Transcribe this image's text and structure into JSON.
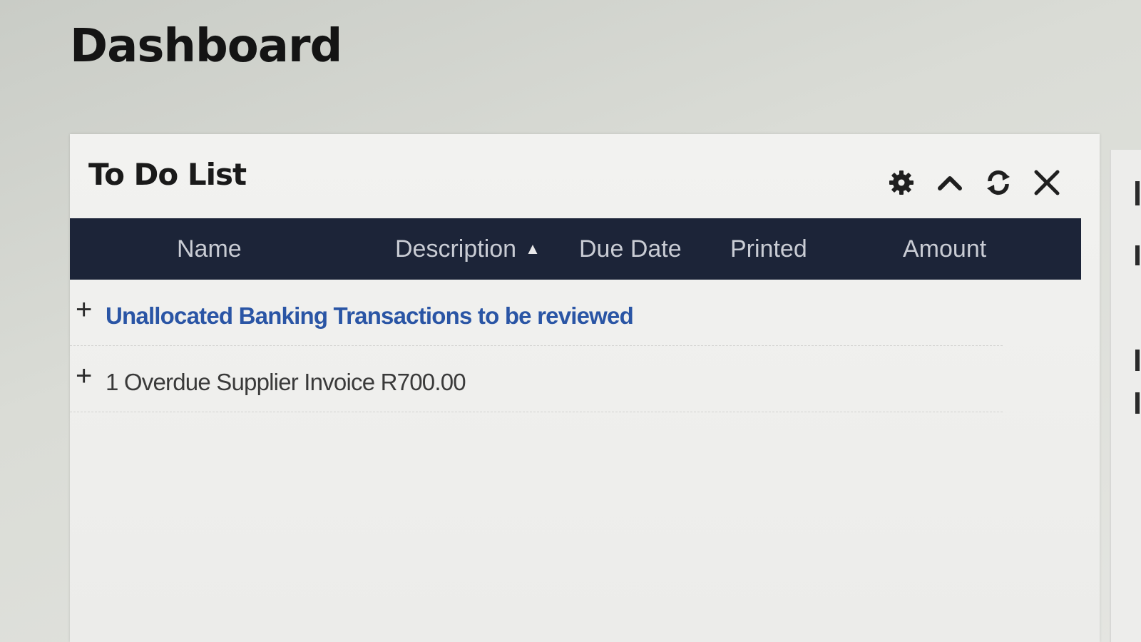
{
  "page": {
    "title": "Dashboard"
  },
  "todo_panel": {
    "title": "To Do List",
    "tools": [
      {
        "name": "settings",
        "icon": "gear-icon"
      },
      {
        "name": "collapse",
        "icon": "chevron-up-icon"
      },
      {
        "name": "refresh",
        "icon": "refresh-icon"
      },
      {
        "name": "close",
        "icon": "close-icon"
      }
    ],
    "columns": [
      {
        "label": "Name"
      },
      {
        "label": "Description",
        "sort": "ascending"
      },
      {
        "label": "Due Date"
      },
      {
        "label": "Printed"
      },
      {
        "label": "Amount"
      }
    ],
    "rows": [
      {
        "expand": "+",
        "text": "Unallocated Banking Transactions to be reviewed",
        "is_link": true
      },
      {
        "expand": "+",
        "text": "1 Overdue Supplier Invoice R700.00",
        "is_link": false
      }
    ]
  },
  "colors": {
    "table_header_bg": "#1c2438",
    "link": "#2a55a5",
    "title": "#141414"
  }
}
